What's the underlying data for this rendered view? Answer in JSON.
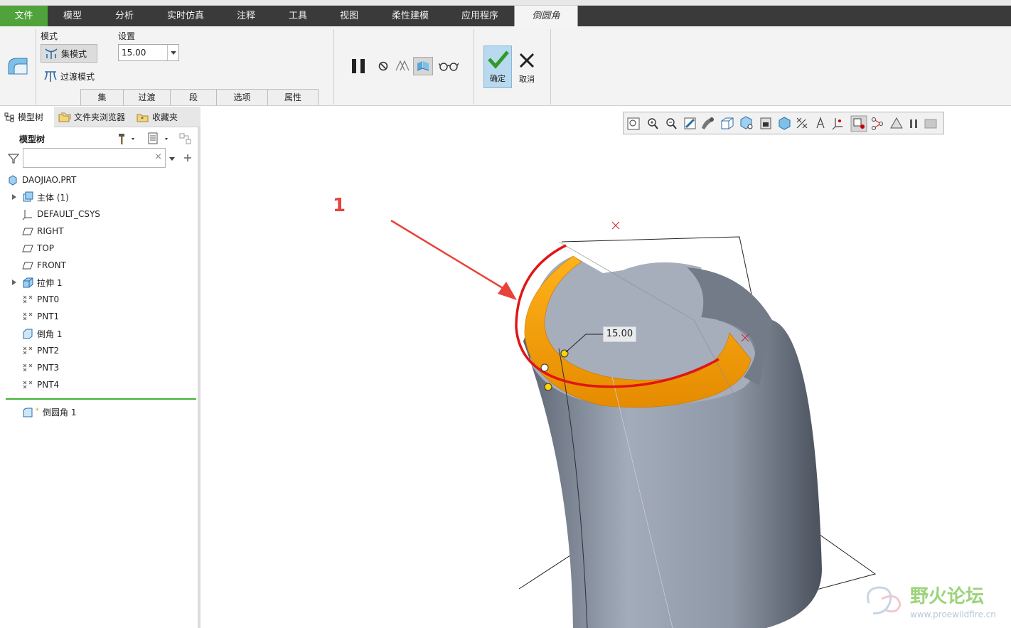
{
  "menubar": {
    "items": [
      "文件",
      "模型",
      "分析",
      "实时仿真",
      "注释",
      "工具",
      "视图",
      "柔性建模",
      "应用程序",
      "倒圆角"
    ]
  },
  "ribbon": {
    "mode_group_label": "模式",
    "settings_group_label": "设置",
    "set_mode_label": "集模式",
    "transition_mode_label": "过渡模式",
    "radius_value": "15.00",
    "subtabs": [
      "集",
      "过渡",
      "段",
      "选项",
      "属性"
    ],
    "ok_label": "确定",
    "cancel_label": "取消"
  },
  "panel": {
    "tabs": [
      "模型树",
      "文件夹浏览器",
      "收藏夹"
    ],
    "tree_title": "模型树",
    "filter_placeholder": "",
    "items": [
      "DAOJIAO.PRT",
      "主体 (1)",
      "DEFAULT_CSYS",
      "RIGHT",
      "TOP",
      "FRONT",
      "拉伸 1",
      "PNT0",
      "PNT1",
      "倒角 1",
      "PNT2",
      "PNT3",
      "PNT4"
    ],
    "insert_item": "倒圆角 1"
  },
  "viewport": {
    "annotation_number": "1",
    "dimension_value": "15.00",
    "watermark_name": "野火论坛",
    "watermark_url": "www.proewildfire.cn"
  },
  "colors": {
    "file_tab": "#4fa33a",
    "menubar": "#3a3a3a",
    "round_highlight": "#f5a300",
    "edge_highlight": "#e01515",
    "model_surface": "#8d96a4"
  }
}
